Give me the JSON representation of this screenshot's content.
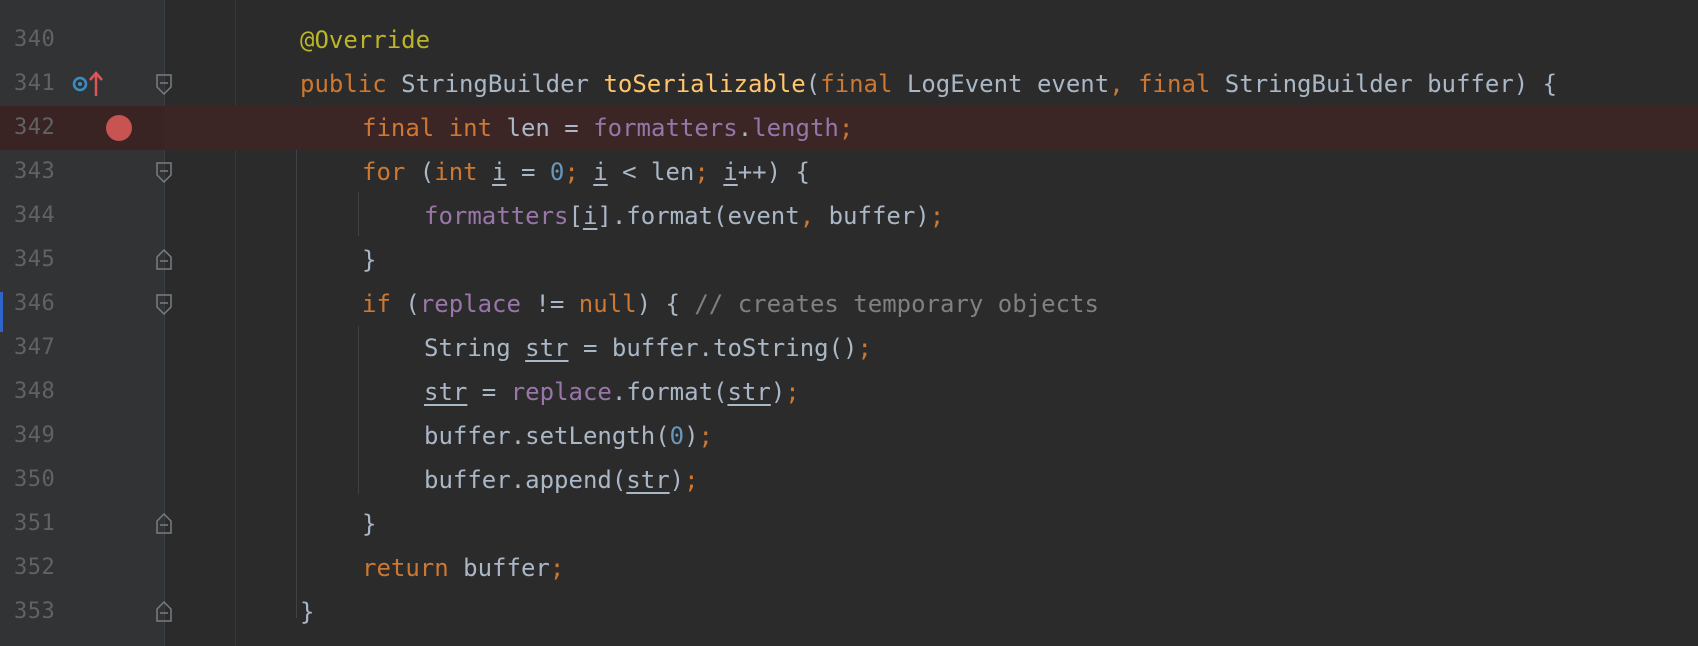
{
  "editor": {
    "breakpoint_color": "#c75450",
    "lines": [
      {
        "num": "340",
        "text": "@Override"
      },
      {
        "num": "341",
        "text": "public StringBuilder toSerializable(final LogEvent event, final StringBuilder buffer) {"
      },
      {
        "num": "342",
        "text": "final int len = formatters.length;"
      },
      {
        "num": "343",
        "text": "for (int i = 0; i < len; i++) {"
      },
      {
        "num": "344",
        "text": "formatters[i].format(event, buffer);"
      },
      {
        "num": "345",
        "text": "}"
      },
      {
        "num": "346",
        "text": "if (replace != null) { // creates temporary objects"
      },
      {
        "num": "347",
        "text": "String str = buffer.toString();"
      },
      {
        "num": "348",
        "text": "str = replace.format(str);"
      },
      {
        "num": "349",
        "text": "buffer.setLength(0);"
      },
      {
        "num": "350",
        "text": "buffer.append(str);"
      },
      {
        "num": "351",
        "text": "}"
      },
      {
        "num": "352",
        "text": "return buffer;"
      },
      {
        "num": "353",
        "text": "}"
      }
    ],
    "gutter_icons": {
      "override": "overrides-method-icon",
      "breakpoint": "breakpoint-icon",
      "fold": "fold-marker-icon"
    }
  }
}
